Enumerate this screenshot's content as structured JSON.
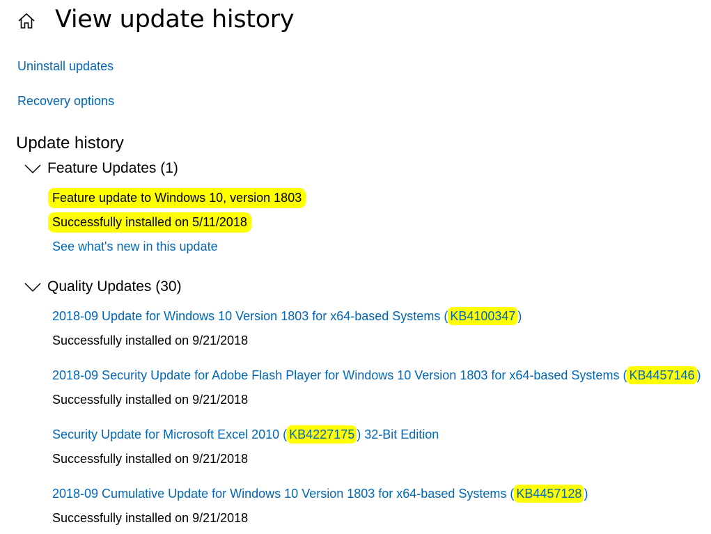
{
  "header": {
    "title": "View update history",
    "home_icon": "home-icon"
  },
  "links": {
    "uninstall": "Uninstall updates",
    "recovery": "Recovery options"
  },
  "update_history": {
    "title": "Update history",
    "feature": {
      "label": "Feature Updates (1)",
      "name": "Feature update to Windows 10, version 1803",
      "status": "Successfully installed on 5/11/2018",
      "link": "See what's new in this update"
    },
    "quality": {
      "label": "Quality Updates (30)",
      "items": [
        {
          "pre": "2018-09 Update for Windows 10 Version 1803 for x64-based Systems (",
          "kb": "KB4100347",
          "post": ")",
          "status": "Successfully installed on 9/21/2018"
        },
        {
          "pre": "2018-09 Security Update for Adobe Flash Player for Windows 10 Version 1803 for x64-based Systems (",
          "kb": "KB4457146",
          "post": ")",
          "status": "Successfully installed on 9/21/2018"
        },
        {
          "pre": "Security Update for Microsoft Excel 2010 (",
          "kb": "KB4227175",
          "post": ") 32-Bit Edition",
          "status": "Successfully installed on 9/21/2018"
        },
        {
          "pre": "2018-09 Cumulative Update for Windows 10 Version 1803 for x64-based Systems (",
          "kb": "KB4457128",
          "post": ")",
          "status": "Successfully installed on 9/21/2018"
        }
      ]
    }
  },
  "colors": {
    "link": "#0067b8",
    "highlight": "#ffff00",
    "text": "#000000",
    "background": "#ffffff"
  }
}
